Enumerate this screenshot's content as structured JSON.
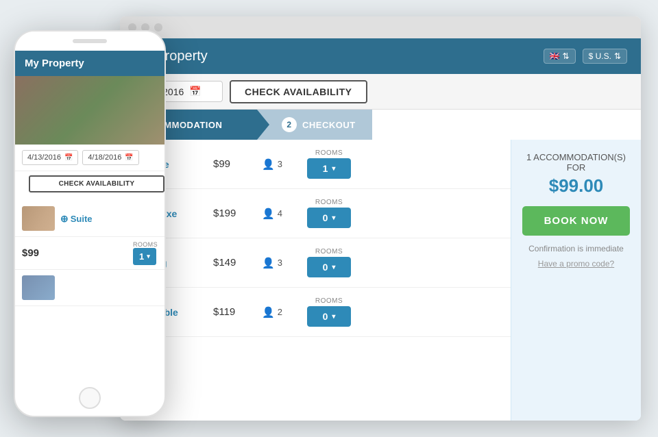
{
  "browser": {
    "dots": [
      "dot1",
      "dot2",
      "dot3"
    ]
  },
  "app": {
    "title": "My Property",
    "flag_label": "🇬🇧",
    "flag_arrows": "⇅",
    "currency_label": "$ U.S.",
    "currency_arrows": "⇅"
  },
  "datebar": {
    "date_value": "4/18/2016",
    "check_avail_label": "CHECK AVAILABILITY"
  },
  "steps": [
    {
      "label": "MMODATION",
      "active": true
    },
    {
      "num": "2",
      "label": "CHECKOUT",
      "active": false
    }
  ],
  "rooms": [
    {
      "name": "Suite",
      "price": "$99",
      "guests": "3",
      "rooms_selected": "1",
      "rooms_label": "ROOMS"
    },
    {
      "name": "Deluxe",
      "price": "$199",
      "guests": "4",
      "rooms_selected": "0",
      "rooms_label": "ROOMS"
    },
    {
      "name": "King",
      "price": "$149",
      "guests": "3",
      "rooms_selected": "0",
      "rooms_label": "ROOMS"
    },
    {
      "name": "Double",
      "price": "$119",
      "guests": "2",
      "rooms_selected": "0",
      "rooms_label": "ROOMS"
    }
  ],
  "sidebar": {
    "accom_label": "1 ACCOMMODATION(S) FOR",
    "price": "$99.00",
    "book_now": "BOOK NOW",
    "confirm_text": "Confirmation is immediate",
    "promo_link": "Have a promo code?"
  },
  "phone": {
    "app_title": "My Property",
    "date_from": "4/13/2016",
    "date_to": "4/18/2016",
    "check_avail_label": "CHECK AVAILABILITY",
    "room_name": "Suite",
    "room_price": "$99",
    "rooms_label": "ROOMS",
    "rooms_selected": "1"
  }
}
